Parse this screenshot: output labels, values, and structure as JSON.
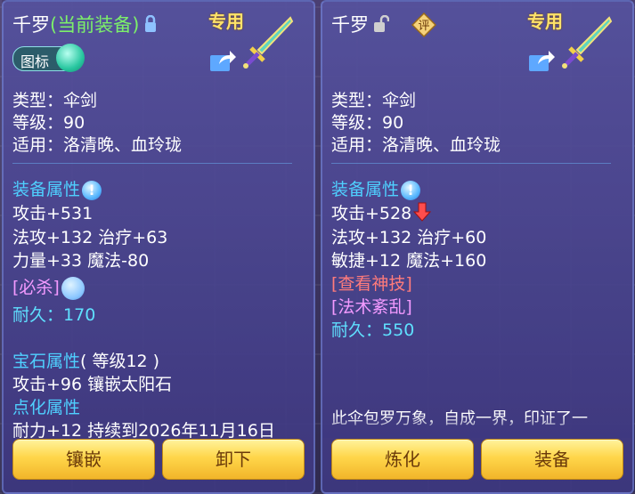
{
  "left": {
    "name": "千罗",
    "equipped_tag": "(当前装备)",
    "special": "专用",
    "toggle_label": "图标",
    "type_line": "类型：伞剑",
    "level_line": "等级：90",
    "fit_line": "适用：洛清晚、血玲珑",
    "attr_header": "装备属性",
    "attr_lines": [
      "攻击+531",
      "法攻+132 治疗+63",
      "力量+33 魔法-80"
    ],
    "special_skill": "[必杀]",
    "durability_label": "耐久：",
    "durability_value": "170",
    "gem_header": "宝石属性",
    "gem_level": "( 等级12 )",
    "gem_line": "攻击+96 镶嵌太阳石",
    "refine_header": "点化属性",
    "refine_line": "耐力+12 持续到2026年11月16日",
    "buttons": [
      "镶嵌",
      "卸下"
    ]
  },
  "right": {
    "name": "千罗",
    "badge": "评",
    "special": "专用",
    "type_line": "类型：伞剑",
    "level_line": "等级：90",
    "fit_line": "适用：洛清晚、血玲珑",
    "attr_header": "装备属性",
    "attr_lines": [
      "攻击+528",
      "法攻+132 治疗+60",
      "敏捷+12 魔法+160"
    ],
    "link1": "[查看神技]",
    "link2": "[法术紊乱]",
    "durability_label": "耐久：",
    "durability_value": "550",
    "desc": "此伞包罗万象，自成一界，印证了一",
    "buttons": [
      "炼化",
      "装备"
    ]
  },
  "colors": {
    "panel": "#56529e",
    "green": "#7cf06a",
    "section_blue": "#4fd0ff",
    "pink": "#f39aff",
    "red": "#ff7b7b",
    "gold_button": "#ffd64a"
  },
  "icons": [
    "lock-icon",
    "unlock-icon",
    "share-icon",
    "sword-icon",
    "info-icon",
    "refresh-icon",
    "down-arrow-icon",
    "rating-badge-icon"
  ]
}
